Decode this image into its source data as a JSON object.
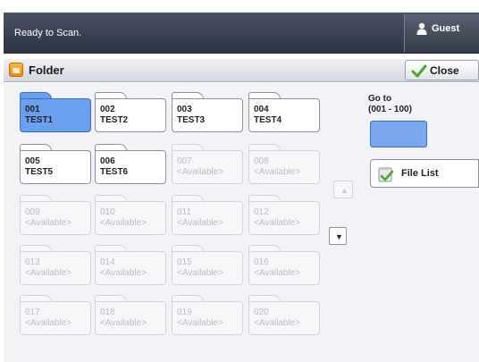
{
  "status": {
    "message": "Ready to Scan.",
    "user_label": "Guest"
  },
  "title_bar": {
    "title": "Folder",
    "close_label": "Close"
  },
  "folders": [
    {
      "number": "001",
      "name": "TEST1",
      "state": "selected"
    },
    {
      "number": "002",
      "name": "TEST2",
      "state": "normal"
    },
    {
      "number": "003",
      "name": "TEST3",
      "state": "normal"
    },
    {
      "number": "004",
      "name": "TEST4",
      "state": "normal"
    },
    {
      "number": "005",
      "name": "TEST5",
      "state": "normal"
    },
    {
      "number": "006",
      "name": "TEST6",
      "state": "normal"
    },
    {
      "number": "007",
      "name": "<Available>",
      "state": "disabled"
    },
    {
      "number": "008",
      "name": "<Available>",
      "state": "disabled"
    },
    {
      "number": "009",
      "name": "<Available>",
      "state": "disabled"
    },
    {
      "number": "010",
      "name": "<Available>",
      "state": "disabled"
    },
    {
      "number": "011",
      "name": "<Available>",
      "state": "disabled"
    },
    {
      "number": "012",
      "name": "<Available>",
      "state": "disabled"
    },
    {
      "number": "013",
      "name": "<Available>",
      "state": "disabled"
    },
    {
      "number": "014",
      "name": "<Available>",
      "state": "disabled"
    },
    {
      "number": "015",
      "name": "<Available>",
      "state": "disabled"
    },
    {
      "number": "016",
      "name": "<Available>",
      "state": "disabled"
    },
    {
      "number": "017",
      "name": "<Available>",
      "state": "disabled"
    },
    {
      "number": "018",
      "name": "<Available>",
      "state": "disabled"
    },
    {
      "number": "019",
      "name": "<Available>",
      "state": "disabled"
    },
    {
      "number": "020",
      "name": "<Available>",
      "state": "disabled"
    }
  ],
  "scroll": {
    "up_arrow": "▲",
    "down_arrow": "▼",
    "up_enabled": false,
    "down_enabled": true
  },
  "goto": {
    "label_line1": "Go to",
    "label_line2": "(001 - 100)",
    "value": ""
  },
  "file_list": {
    "label": "File List"
  },
  "colors": {
    "selected_fill": "#6aa0ee",
    "status_bar": "#2c3240",
    "accent_green": "#5cb82e"
  }
}
